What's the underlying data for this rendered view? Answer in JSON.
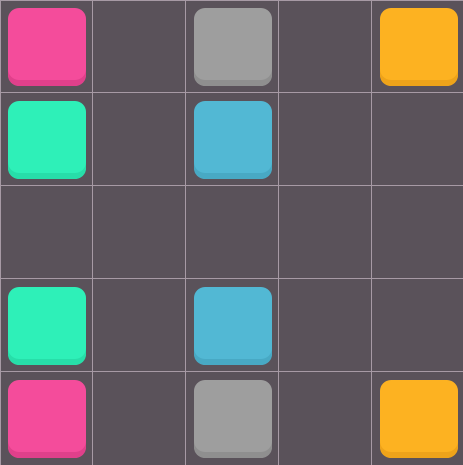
{
  "board": {
    "rows": 5,
    "cols": 5,
    "grid": [
      [
        "pink",
        null,
        "gray",
        null,
        "orange"
      ],
      [
        "teal",
        null,
        "blue",
        null,
        null
      ],
      [
        null,
        null,
        null,
        null,
        null
      ],
      [
        "teal",
        null,
        "blue",
        null,
        null
      ],
      [
        "pink",
        null,
        "gray",
        null,
        "orange"
      ]
    ]
  },
  "colors": {
    "background": "#5a525a",
    "grid_line": "#a79aa5",
    "pink": "#f44c9b",
    "pink_shade": "#e0408b",
    "gray": "#9e9e9e",
    "gray_shade": "#8f8f8f",
    "orange": "#fdb221",
    "orange_shade": "#eea31a",
    "teal": "#2ef0b8",
    "teal_shade": "#27dea9",
    "blue": "#52b8d4",
    "blue_shade": "#48a9c4"
  }
}
